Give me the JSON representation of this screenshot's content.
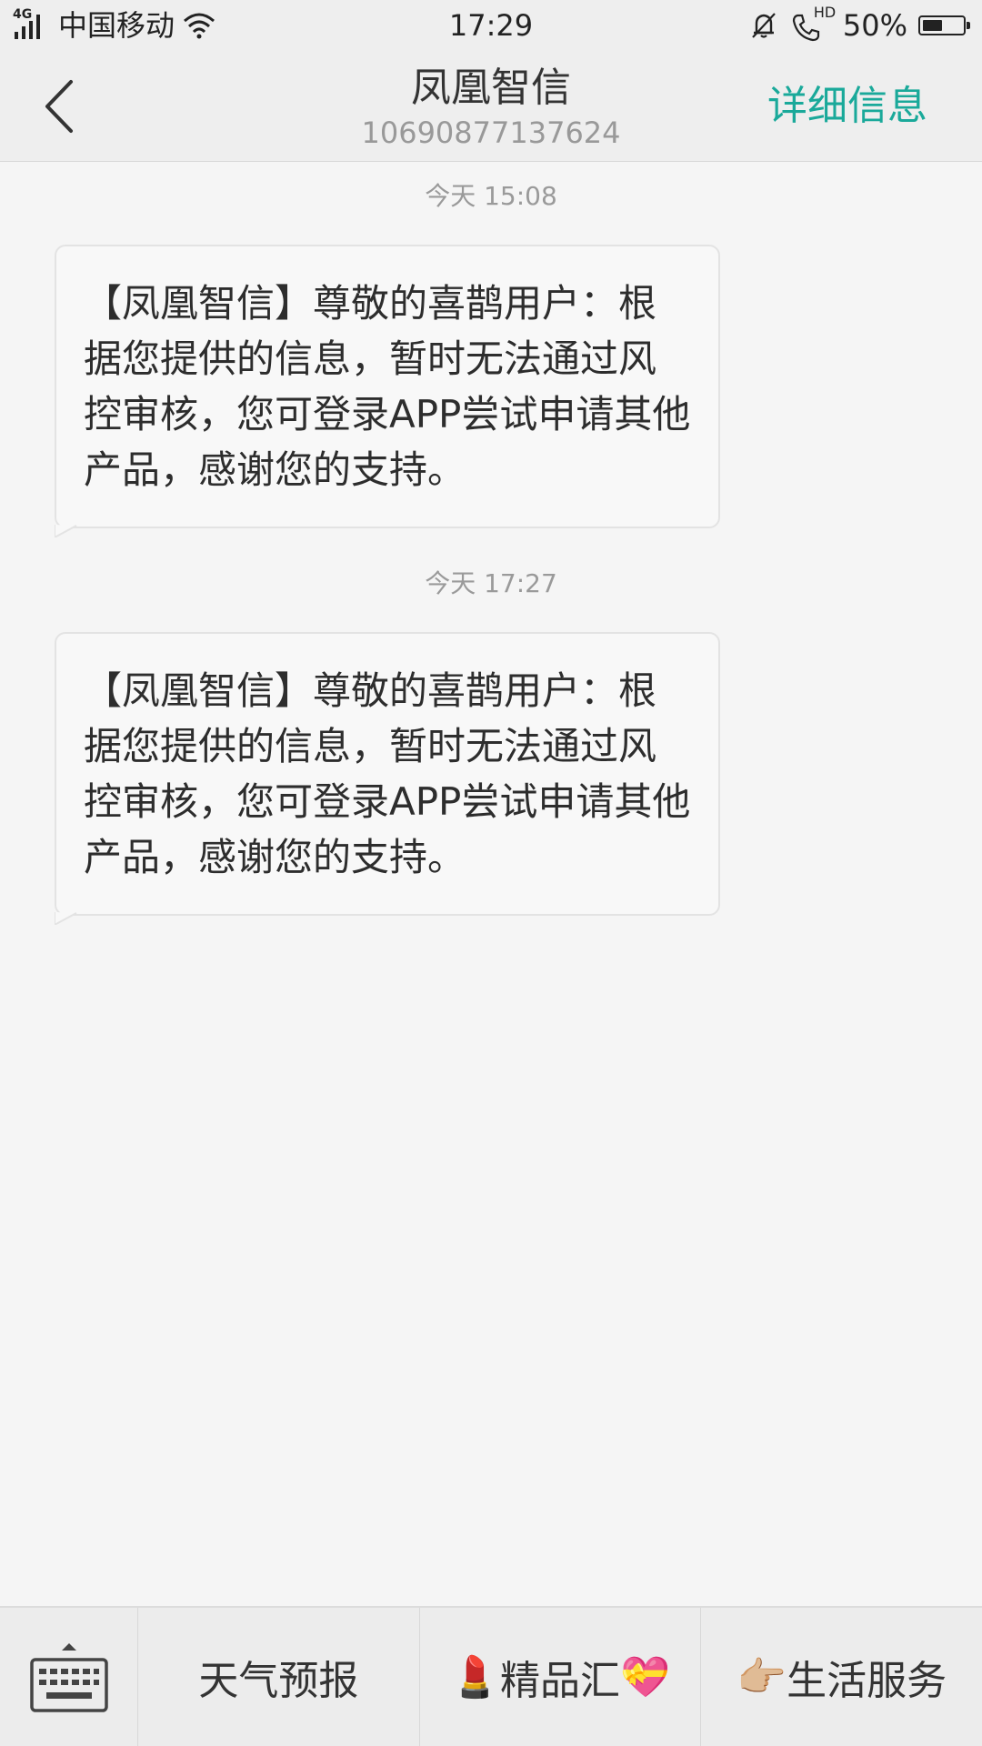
{
  "status_bar": {
    "network": "4G",
    "carrier": "中国移动",
    "time": "17:29",
    "hd": "HD",
    "battery": "50%",
    "battery_level": 0.5
  },
  "header": {
    "title": "凤凰智信",
    "number": "10690877137624",
    "details_label": "详细信息",
    "accent_color": "#1aa99a"
  },
  "messages": [
    {
      "time": "今天 15:08",
      "text": "【凤凰智信】尊敬的喜鹊用户：根据您提供的信息，暂时无法通过风控审核，您可登录APP尝试申请其他产品，感谢您的支持。"
    },
    {
      "time": "今天 17:27",
      "text": "【凤凰智信】尊敬的喜鹊用户：根据您提供的信息，暂时无法通过风控审核，您可登录APP尝试申请其他产品，感谢您的支持。"
    }
  ],
  "bottom_menu": {
    "items": [
      {
        "prefix": "",
        "label": "天气预报",
        "suffix": ""
      },
      {
        "prefix": "💄",
        "label": "精品汇",
        "suffix": "💝"
      },
      {
        "prefix": "👉🏼",
        "label": "生活服务",
        "suffix": ""
      }
    ]
  }
}
